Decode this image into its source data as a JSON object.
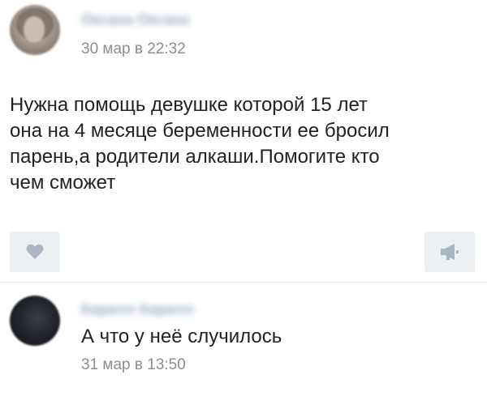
{
  "post": {
    "author_name": "Оксана Оксана",
    "date": "30 мар в 22:32",
    "text": "Нужна помощь девушке которой 15 лет\nона на 4 месяце беременности ее бросил\nпарень,а родители алкаши.Помогите кто\nчем сможет",
    "like_icon": "heart-icon",
    "share_icon": "megaphone-icon"
  },
  "comment": {
    "author_name": "Кирилл Кирилл",
    "text": "А что у неё случилось",
    "date": "31 мар в 13:50"
  },
  "colors": {
    "author_link": "#6e87a8",
    "meta_text": "#8d8d8d",
    "button_bg": "#edf0f3",
    "icon": "#aab6c4"
  }
}
